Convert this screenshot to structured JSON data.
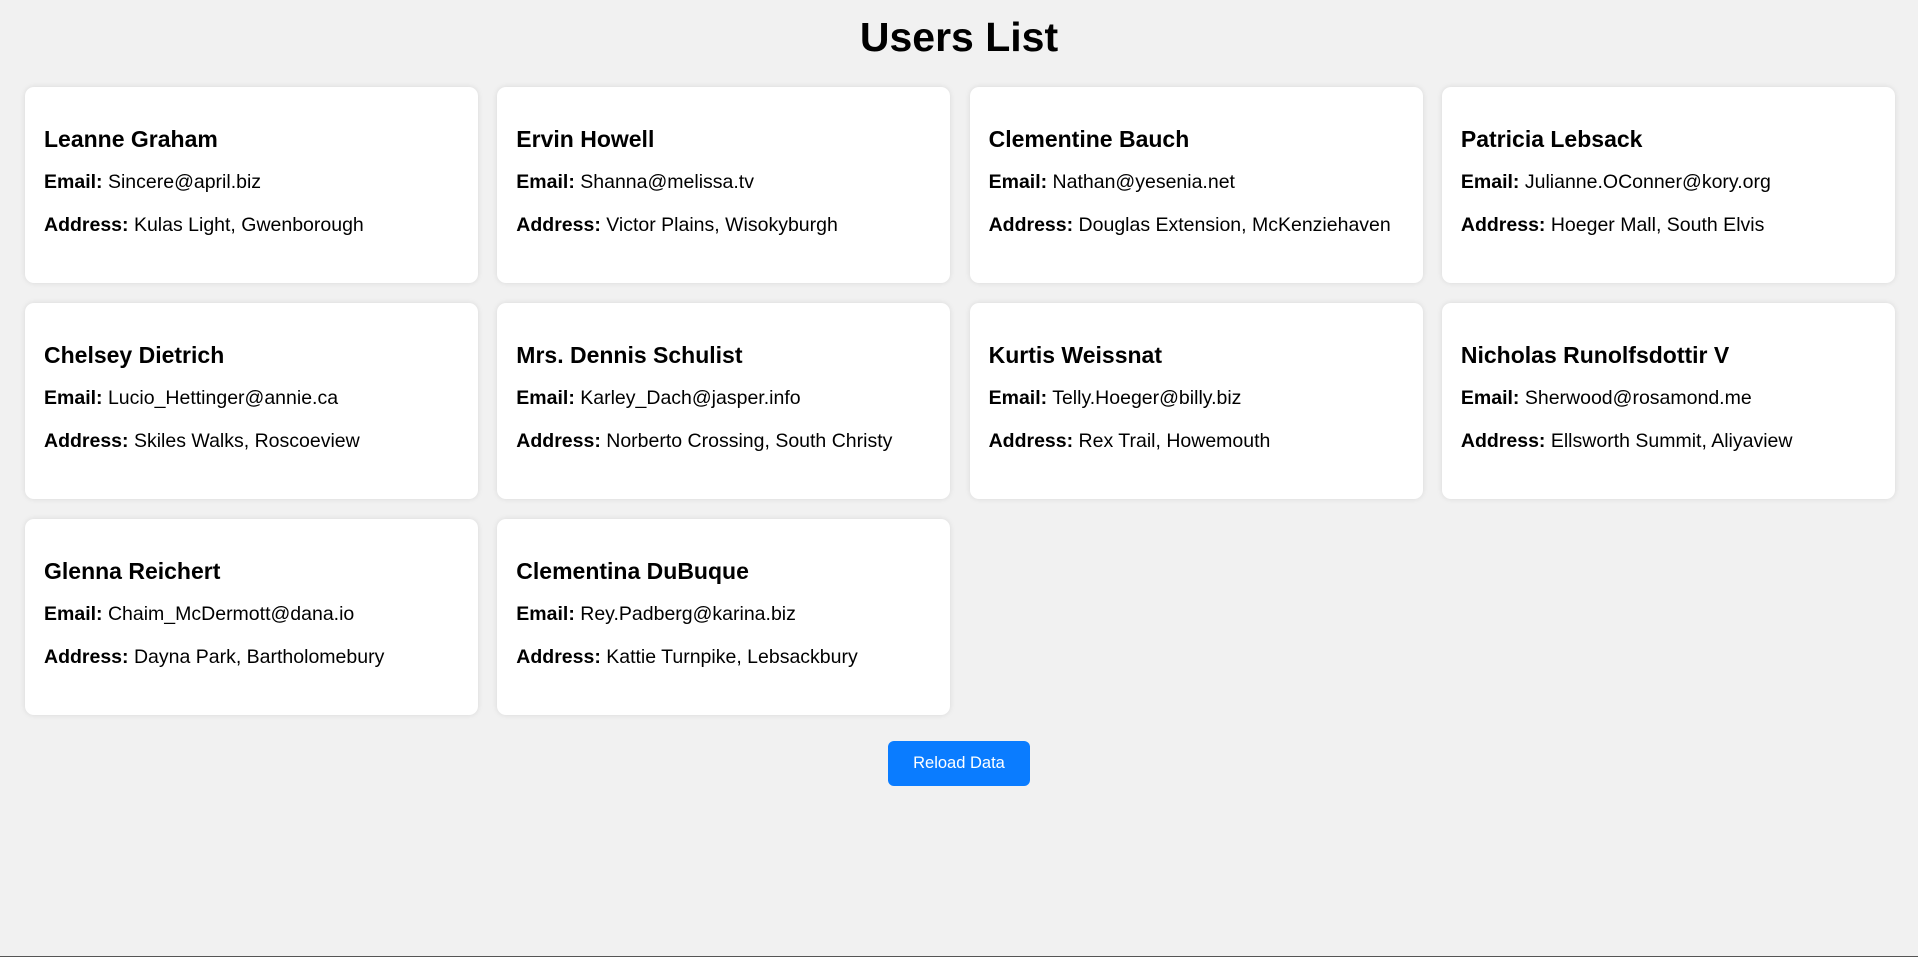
{
  "page": {
    "title": "Users List"
  },
  "labels": {
    "email": "Email:",
    "address": "Address:"
  },
  "users": [
    {
      "name": "Leanne Graham",
      "email": "Sincere@april.biz",
      "address": "Kulas Light, Gwenborough"
    },
    {
      "name": "Ervin Howell",
      "email": "Shanna@melissa.tv",
      "address": "Victor Plains, Wisokyburgh"
    },
    {
      "name": "Clementine Bauch",
      "email": "Nathan@yesenia.net",
      "address": "Douglas Extension, McKenziehaven"
    },
    {
      "name": "Patricia Lebsack",
      "email": "Julianne.OConner@kory.org",
      "address": "Hoeger Mall, South Elvis"
    },
    {
      "name": "Chelsey Dietrich",
      "email": "Lucio_Hettinger@annie.ca",
      "address": "Skiles Walks, Roscoeview"
    },
    {
      "name": "Mrs. Dennis Schulist",
      "email": "Karley_Dach@jasper.info",
      "address": "Norberto Crossing, South Christy"
    },
    {
      "name": "Kurtis Weissnat",
      "email": "Telly.Hoeger@billy.biz",
      "address": "Rex Trail, Howemouth"
    },
    {
      "name": "Nicholas Runolfsdottir V",
      "email": "Sherwood@rosamond.me",
      "address": "Ellsworth Summit, Aliyaview"
    },
    {
      "name": "Glenna Reichert",
      "email": "Chaim_McDermott@dana.io",
      "address": "Dayna Park, Bartholomebury"
    },
    {
      "name": "Clementina DuBuque",
      "email": "Rey.Padberg@karina.biz",
      "address": "Kattie Turnpike, Lebsackbury"
    }
  ],
  "actions": {
    "reload_label": "Reload Data"
  },
  "colors": {
    "background": "#f1f1f1",
    "card": "#ffffff",
    "button": "#0a7cff",
    "button_text": "#ffffff"
  }
}
